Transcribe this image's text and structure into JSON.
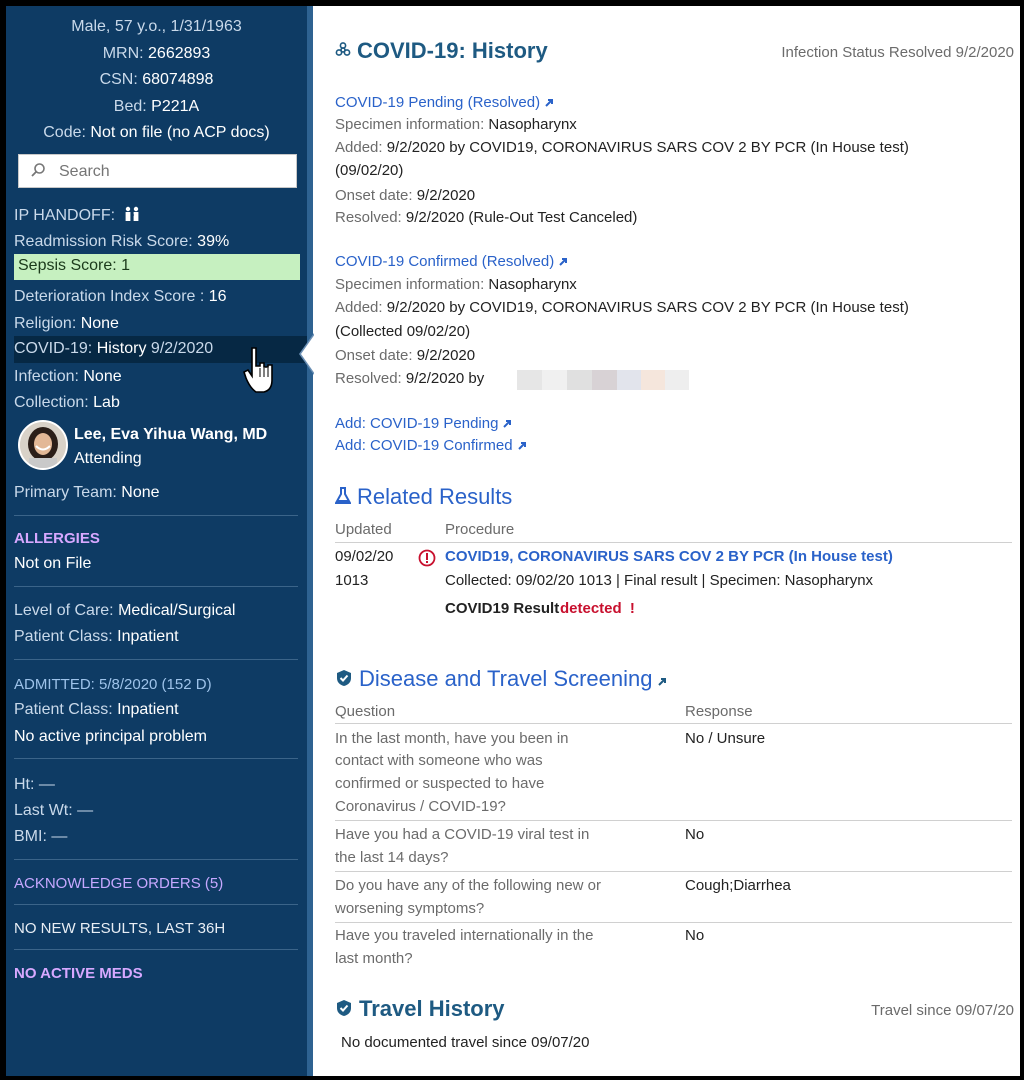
{
  "patient": {
    "demographics": "Male, 57 y.o., 1/31/1963",
    "mrn_label": "MRN: ",
    "mrn": "2662893",
    "csn_label": "CSN: ",
    "csn": "68074898",
    "bed_label": "Bed: ",
    "bed": "P221A",
    "code_label": "Code: ",
    "code": "Not on file (no ACP docs)"
  },
  "search": {
    "placeholder": "Search"
  },
  "sidebar": {
    "ip_handoff": "IP HANDOFF:",
    "readmission_label": "Readmission Risk Score: ",
    "readmission": "39%",
    "sepsis": "Sepsis Score: 1",
    "deterioration_label": "Deterioration Index Score : ",
    "deterioration": "16",
    "religion_label": "Religion: ",
    "religion": "None",
    "covid_label": "COVID-19: ",
    "covid_value": "History",
    "covid_date": " 9/2/2020",
    "infection_label": "Infection: ",
    "infection": "None",
    "collection_label": "Collection: ",
    "collection": "Lab",
    "provider_name": "Lee, Eva Yihua Wang, MD",
    "provider_role": "Attending",
    "primary_team_label": "Primary Team: ",
    "primary_team": "None",
    "allergies_header": "ALLERGIES",
    "allergies_value": "Not on File",
    "level_of_care_label": "Level of Care: ",
    "level_of_care": "Medical/Surgical",
    "patient_class_label": "Patient Class: ",
    "patient_class": "Inpatient",
    "admitted": "ADMITTED: 5/8/2020 (152 D)",
    "patient_class_label2": "Patient Class: ",
    "patient_class2": "Inpatient",
    "principal_problem": "No active principal problem",
    "ht": "Ht: —",
    "last_wt": "Last Wt: —",
    "bmi": "BMI: —",
    "acknowledge_orders": "ACKNOWLEDGE ORDERS (5)",
    "no_new_results": "NO NEW RESULTS, LAST 36H",
    "no_active_meds": "NO ACTIVE MEDS"
  },
  "covid_history": {
    "title": "COVID-19: History",
    "status": "Infection Status Resolved 9/2/2020",
    "pending": {
      "link": "COVID-19 Pending (Resolved)",
      "specimen_label": "Specimen information: ",
      "specimen": "Nasopharynx",
      "added_label": "Added: ",
      "added": "9/2/2020 by COVID19, CORONAVIRUS SARS COV 2 BY PCR (In House test)",
      "added_cont": "(09/02/20)",
      "onset_label": "Onset date: ",
      "onset": "9/2/2020",
      "resolved_label": "Resolved: ",
      "resolved": "9/2/2020 (Rule-Out Test Canceled)"
    },
    "confirmed": {
      "link": "COVID-19 Confirmed (Resolved)",
      "specimen_label": "Specimen information: ",
      "specimen": "Nasopharynx",
      "added_label": "Added: ",
      "added": "9/2/2020 by COVID19, CORONAVIRUS SARS COV 2 BY PCR (In House test)",
      "added_cont": "(Collected 09/02/20)",
      "onset_label": "Onset date: ",
      "onset": "9/2/2020",
      "resolved_label": "Resolved: ",
      "resolved": "9/2/2020 by"
    },
    "add_pending": "Add: COVID-19 Pending",
    "add_confirmed": "Add: COVID-19 Confirmed"
  },
  "related_results": {
    "title": "Related Results",
    "col_updated": "Updated",
    "col_procedure": "Procedure",
    "date": "09/02/20",
    "time": "1013",
    "procedure": "COVID19, CORONAVIRUS SARS COV 2 BY PCR (In House test)",
    "details": "Collected: 09/02/20 1013 | Final result | Specimen: Nasopharynx",
    "result_label": "COVID19 Result",
    "result_value": "detected",
    "result_flag": "!"
  },
  "screening": {
    "title": "Disease and Travel Screening",
    "col_question": "Question",
    "col_response": "Response",
    "rows": [
      {
        "q1": "In the last month, have you been in",
        "q2": "contact with someone who was",
        "q3": "confirmed or suspected to have",
        "q4": "Coronavirus / COVID-19?",
        "a": "No / Unsure"
      },
      {
        "q1": "Have you had a COVID-19 viral test in",
        "q2": "the last 14 days?",
        "a": "No"
      },
      {
        "q1": "Do you have any of the following new or",
        "q2": "worsening symptoms?",
        "a": "Cough;Diarrhea"
      },
      {
        "q1": "Have you traveled internationally in the",
        "q2": "last month?",
        "a": "No"
      }
    ]
  },
  "travel": {
    "title": "Travel History",
    "since": "Travel since 09/07/20",
    "none": "No documented travel since 09/07/20"
  },
  "colors": {
    "sidebar_bg": "#0e3b64",
    "link": "#2a62c9",
    "heading": "#1e5a82",
    "sepsis_bg": "#c6f0c0",
    "alert_red": "#c8102e",
    "section_purple": "#d7a8ff"
  }
}
